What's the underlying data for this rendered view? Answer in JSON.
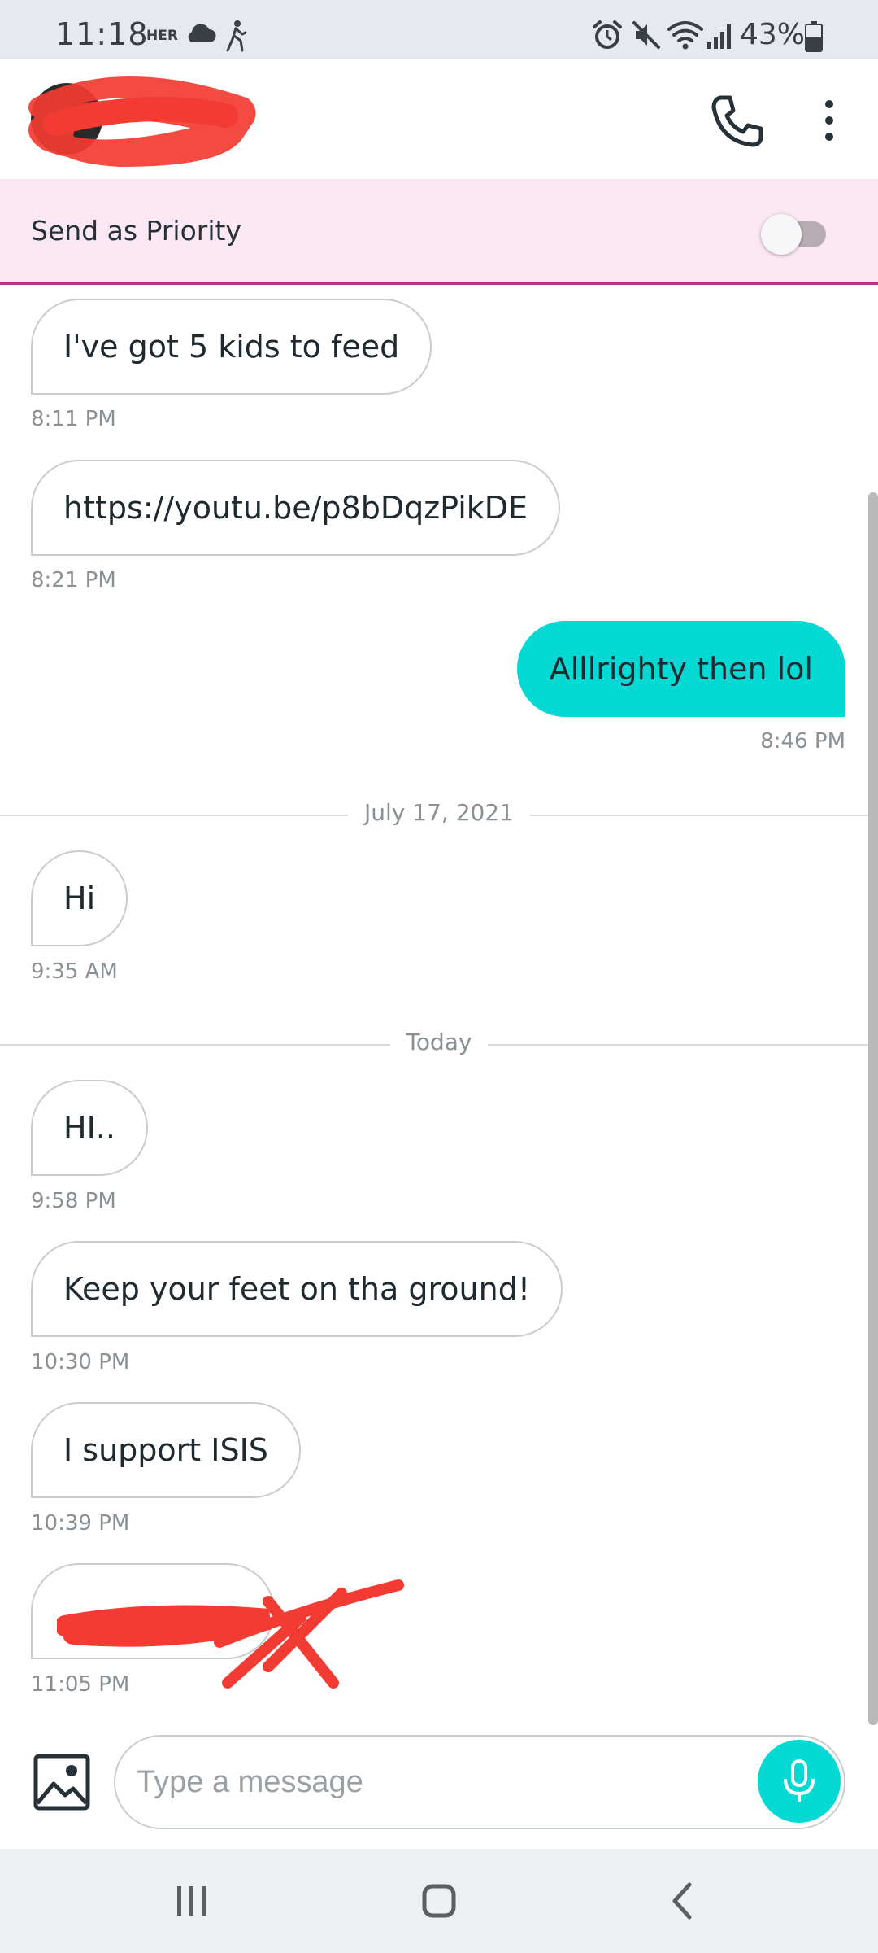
{
  "status_bar": {
    "time": "11:18",
    "carrier": "HER",
    "battery_percent": "43%",
    "icons": [
      "cloud-icon",
      "walking-icon",
      "alarm-icon",
      "mute-icon",
      "wifi-icon",
      "signal-icon",
      "battery-icon"
    ]
  },
  "header": {
    "contact_name_redacted": true,
    "icons": [
      "phone-icon",
      "more-vert-icon"
    ]
  },
  "priority": {
    "label": "Send as Priority",
    "enabled": false
  },
  "messages": [
    {
      "direction": "incoming",
      "text": "I've got 5 kids to feed",
      "time": "8:11 PM"
    },
    {
      "direction": "incoming",
      "text": "https://youtu.be/p8bDqzPikDE",
      "time": "8:21 PM"
    },
    {
      "direction": "outgoing",
      "text": "Alllrighty then lol",
      "time": "8:46 PM"
    },
    {
      "divider": "July 17, 2021"
    },
    {
      "direction": "incoming",
      "text": "Hi",
      "time": "9:35 AM"
    },
    {
      "divider": "Today"
    },
    {
      "direction": "incoming",
      "text": "HI..",
      "time": "9:58 PM"
    },
    {
      "direction": "incoming",
      "text": "Keep your feet on tha ground!",
      "time": "10:30 PM"
    },
    {
      "direction": "incoming",
      "text": "I support ISIS",
      "time": "10:39 PM"
    },
    {
      "direction": "incoming",
      "text": "",
      "redacted": true,
      "time": "11:05 PM"
    }
  ],
  "composer": {
    "placeholder": "Type a message",
    "value": ""
  },
  "colors": {
    "accent": "#05d9d4",
    "priority_bg": "#fce8f3",
    "priority_border": "#b1338c",
    "redaction": "#f23b32"
  }
}
